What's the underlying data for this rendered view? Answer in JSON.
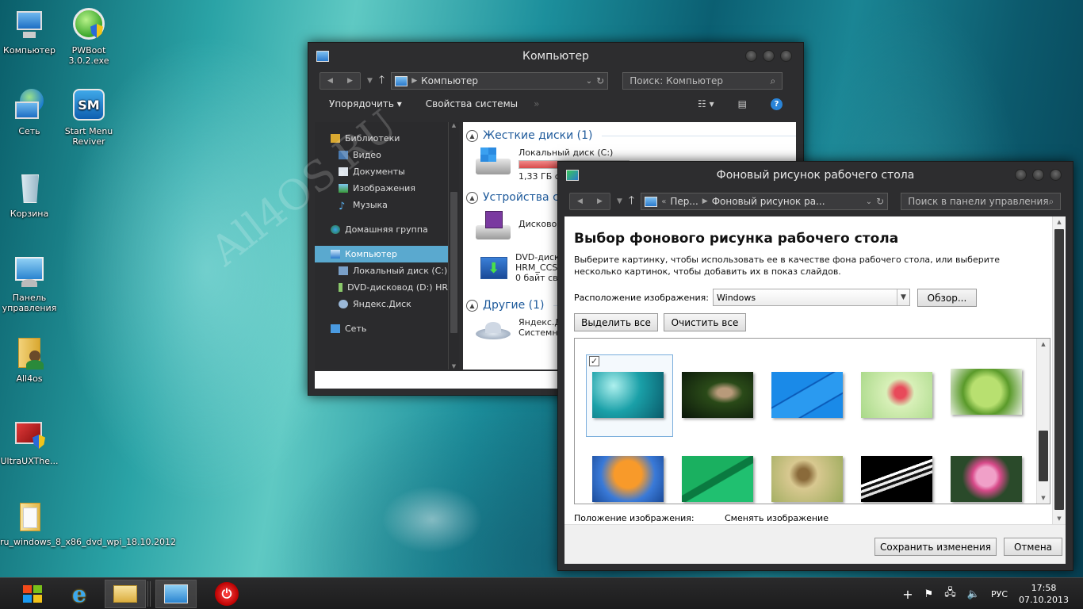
{
  "desktop": {
    "icons": [
      {
        "label": "Компьютер"
      },
      {
        "label": "PWBoot 3.0.2.exe"
      },
      {
        "label": "Сеть"
      },
      {
        "label": "Start Menu Reviver"
      },
      {
        "label": "Корзина"
      },
      {
        "label": "Панель управления"
      },
      {
        "label": "All4os"
      },
      {
        "label": "UltraUXThe..."
      },
      {
        "label": "ru_windows_8_x86_dvd_wpi_18.10.2012"
      }
    ],
    "watermark": "All4OS.RU"
  },
  "explorer": {
    "title": "Компьютер",
    "address": "Компьютер",
    "search_placeholder": "Поиск: Компьютер",
    "toolbar": {
      "organize": "Упорядочить",
      "properties": "Свойства системы"
    },
    "tree": [
      {
        "label": "Библиотеки"
      },
      {
        "label": "Видео"
      },
      {
        "label": "Документы"
      },
      {
        "label": "Изображения"
      },
      {
        "label": "Музыка"
      },
      {
        "label": "Домашняя группа"
      },
      {
        "label": "Компьютер"
      },
      {
        "label": "Локальный диск (C:)"
      },
      {
        "label": "DVD-дисковод (D:) HR"
      },
      {
        "label": "Яндекс.Диск"
      },
      {
        "label": "Сеть"
      }
    ],
    "groups": {
      "hdd": "Жесткие диски (1)",
      "devices": "Устройства со",
      "other": "Другие (1)"
    },
    "items": {
      "local_disk": "Локальный диск (C:)",
      "local_free": "1,33 ГБ св",
      "disk_usage": 0.87,
      "floppy": "Дисковод",
      "dvd_name": "DVD-диск",
      "dvd_label": "HRM_CCS",
      "dvd_free": "0 байт св",
      "yandex_name": "Яндекс.Д",
      "yandex_type": "Системна"
    }
  },
  "wallpaper_dialog": {
    "title": "Фоновый рисунок рабочего стола",
    "breadcrumb": {
      "first": "Пер...",
      "second": "Фоновый рисунок ра..."
    },
    "search_placeholder": "Поиск в панели управления",
    "heading": "Выбор фонового рисунка рабочего стола",
    "description": "Выберите картинку, чтобы использовать ее в качестве фона рабочего стола, или выберите несколько картинок, чтобы добавить их в показ слайдов.",
    "location_label": "Расположение изображения:",
    "location_value": "Windows",
    "browse": "Обзор...",
    "select_all": "Выделить все",
    "clear_all": "Очистить все",
    "position_label": "Положение изображения:",
    "change_label": "Сменять изображение",
    "save": "Сохранить изменения",
    "cancel": "Отмена",
    "thumbnails": [
      {
        "name": "teal-drops",
        "selected": true
      },
      {
        "name": "pine-cones",
        "selected": false
      },
      {
        "name": "blue-lines",
        "selected": false
      },
      {
        "name": "pink-flower",
        "selected": false
      },
      {
        "name": "green-leaf",
        "selected": false
      },
      {
        "name": "orange-leaves",
        "selected": false
      },
      {
        "name": "green-glass",
        "selected": false
      },
      {
        "name": "owl",
        "selected": false
      },
      {
        "name": "piano",
        "selected": false
      },
      {
        "name": "lotus",
        "selected": false
      }
    ]
  },
  "taskbar": {
    "language": "РУС",
    "time": "17:58",
    "date": "07.10.2013"
  }
}
